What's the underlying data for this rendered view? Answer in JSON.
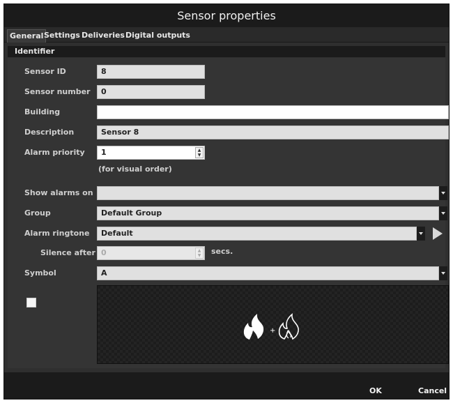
{
  "window": {
    "title": "Sensor properties"
  },
  "tabs": [
    {
      "label": "General"
    },
    {
      "label": "Settings"
    },
    {
      "label": "Deliveries"
    },
    {
      "label": "Digital outputs"
    }
  ],
  "section": {
    "title": "Identifier"
  },
  "fields": {
    "sensor_id": {
      "label": "Sensor ID",
      "value": "8"
    },
    "sensor_number": {
      "label": "Sensor number",
      "value": "0"
    },
    "building": {
      "label": "Building",
      "value": ""
    },
    "description": {
      "label": "Description",
      "value": "Sensor 8"
    },
    "alarm_priority": {
      "label": "Alarm priority",
      "value": "1",
      "hint": "(for visual order)"
    },
    "show_alarms_on": {
      "label": "Show alarms on",
      "value": ""
    },
    "group": {
      "label": "Group",
      "value": "Default Group"
    },
    "alarm_ringtone": {
      "label": "Alarm ringtone",
      "value": "Default"
    },
    "silence_after": {
      "label": "Silence after",
      "value": "0",
      "unit": "secs.",
      "checked": false
    },
    "symbol": {
      "label": "Symbol",
      "value": "A"
    }
  },
  "buttons": {
    "ok": "OK",
    "cancel": "Cancel"
  },
  "icons": {
    "fire": "fire-icon",
    "play": "play-icon",
    "dropdown": "chevron-down-icon",
    "spinner": "stepper-icon"
  },
  "colors": {
    "window_bg": "#2f2f2f",
    "title_bg": "#1b1b1b",
    "field_bg": "#e0e0e0"
  }
}
